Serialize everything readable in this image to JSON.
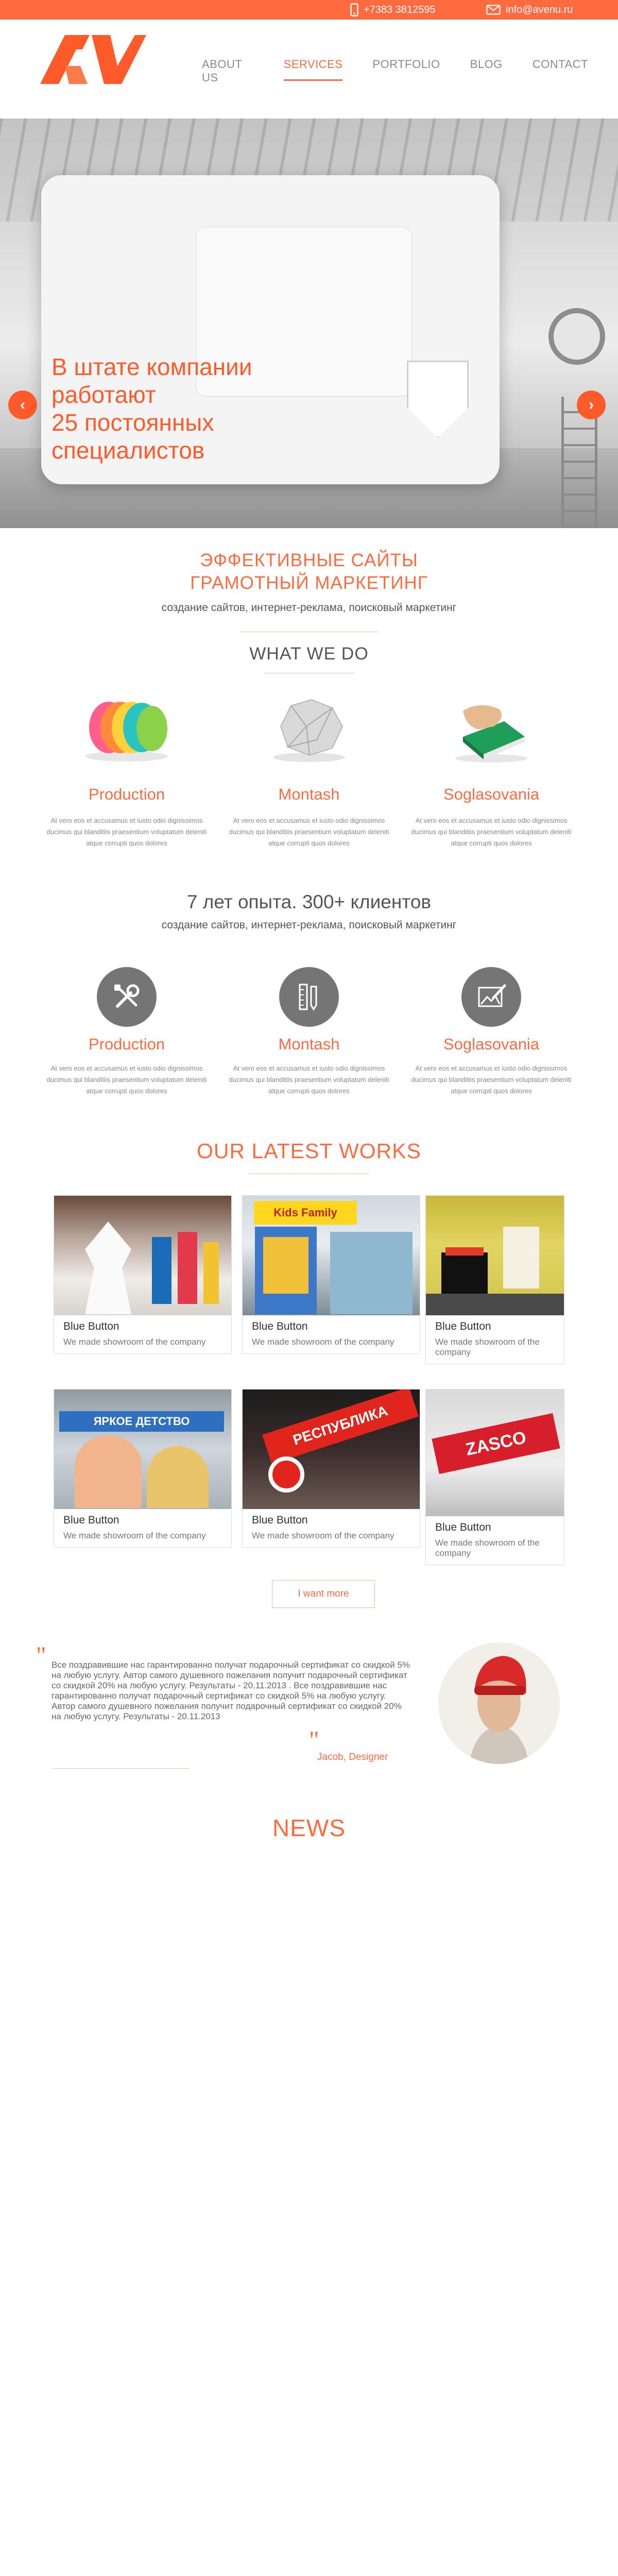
{
  "topbar": {
    "phone": "+7383 3812595",
    "email": "info@avenu.ru",
    "bg_color": "#ff6a3f"
  },
  "brand": {
    "logo_text": "AV",
    "accent_color": "#ff6a3f"
  },
  "nav": {
    "items": [
      {
        "label": "ABOUT US",
        "active": false
      },
      {
        "label": "SERVICES",
        "active": true
      },
      {
        "label": "PORTFOLIO",
        "active": false
      },
      {
        "label": "BLOG",
        "active": false
      },
      {
        "label": "CONTACT",
        "active": false
      }
    ]
  },
  "hero": {
    "lines": [
      "В штате компании",
      "работают",
      "25 постоянных",
      "специалистов"
    ],
    "prev_icon": "chevron-left-icon",
    "next_icon": "chevron-right-icon"
  },
  "intro": {
    "title_line1": "ЭФФЕКТИВНЫЕ САЙТЫ",
    "title_line2": "ГРАМОТНЫЙ МАРКЕТИНГ",
    "subtitle": "создание сайтов, интернет-реклама, поисковый маркетинг"
  },
  "what_we_do": {
    "heading": "WHAT WE DO",
    "services": [
      {
        "name": "Production",
        "desc": "At vero eos et accusamus et iusto odio dignissimos ducimus qui blanditiis praesentium voluptatum deleniti atque corrupti quos dolores"
      },
      {
        "name": "Montash",
        "desc": "At vero eos et accusamus et iusto odio dignissimos ducimus qui blanditiis praesentium voluptatum deleniti atque corrupti quos dolores"
      },
      {
        "name": "Soglasovania",
        "desc": "At vero eos et accusamus et iusto odio dignissimos ducimus qui blanditiis praesentium voluptatum deleniti atque corrupti quos dolores"
      }
    ]
  },
  "experience": {
    "heading": "7 лет опыта. 300+ клиентов",
    "subtitle": "создание сайтов, интернет-реклама, поисковый маркетинг",
    "services": [
      {
        "name": "Production",
        "icon": "tools-icon",
        "desc": "At vero eos et accusamus et iusto odio dignissimos ducimus qui blanditiis praesentium voluptatum deleniti atque corrupti quos dolores"
      },
      {
        "name": "Montash",
        "icon": "ruler-pencil-icon",
        "desc": "At vero eos et accusamus et iusto odio dignissimos ducimus qui blanditiis praesentium voluptatum deleniti atque corrupti quos dolores"
      },
      {
        "name": "Soglasovania",
        "icon": "edit-picture-icon",
        "desc": "At vero eos et accusamus et iusto odio dignissimos ducimus qui blanditiis praesentium voluptatum deleniti atque corrupti quos dolores"
      }
    ]
  },
  "works": {
    "heading": "OUR LATEST WORKS",
    "items": [
      {
        "title": "Blue Button",
        "caption": "We made showroom of the company"
      },
      {
        "title": "Blue Button",
        "caption": "We made showroom of the company",
        "sign": "Kids Family"
      },
      {
        "title": "Blue Button",
        "caption": "We made showroom of the company"
      },
      {
        "title": "Blue Button",
        "caption": "We made showroom of the company",
        "sign": "ЯРКОЕ ДЕТСТВО"
      },
      {
        "title": "Blue Button",
        "caption": "We made showroom of the company",
        "sign": "РЕСПУБЛИКА"
      },
      {
        "title": "Blue Button",
        "caption": "We made showroom of the company",
        "sign": "ZASCO"
      }
    ],
    "more_label": "I want more"
  },
  "testimonial": {
    "text": "Все поздравившие нас гарантированно получат подарочный сертификат со скидкой 5% на любую услугу. Автор самого душевного пожелания получит подарочный сертификат со скидкой 20% на любую услугу. Результаты - 20.11.2013 . Все поздравившие нас гарантированно получат подарочный сертификат со скидкой 5% на любую услугу. Автор самого душевного пожелания получит подарочный сертификат со скидкой 20% на любую услугу. Результаты - 20.11.2013",
    "author": "Jacob, Designer",
    "open_quote": "\"",
    "close_quote": "\""
  },
  "news": {
    "heading": "NEWS"
  }
}
